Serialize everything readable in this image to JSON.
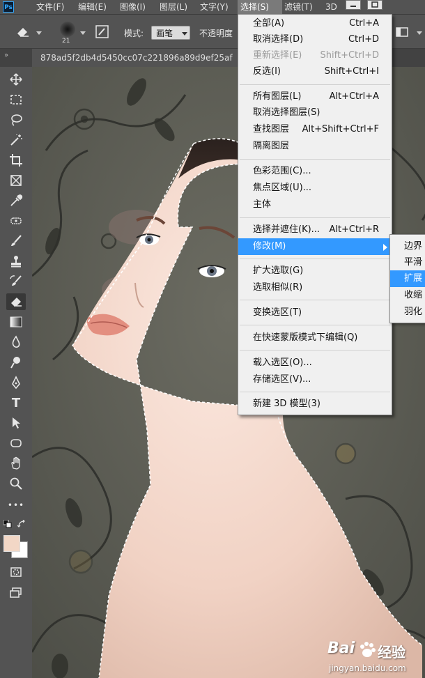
{
  "app": {
    "logo_text": "Ps"
  },
  "menubar": {
    "items": [
      {
        "label": "文件(F)"
      },
      {
        "label": "编辑(E)"
      },
      {
        "label": "图像(I)"
      },
      {
        "label": "图层(L)"
      },
      {
        "label": "文字(Y)"
      },
      {
        "label": "选择(S)"
      },
      {
        "label": "滤镜(T)"
      },
      {
        "label": "3D"
      }
    ],
    "active_item": "选择(S)"
  },
  "options_bar": {
    "brush_size": "21",
    "mode_label": "模式:",
    "mode_value": "画笔",
    "opacity_label": "不透明度"
  },
  "document": {
    "tab_title": "878ad5f2db4d5450cc07c221896a89d9ef25af"
  },
  "toolbar": {
    "tools": [
      "move-tool-icon",
      "marquee-tool-icon",
      "lasso-tool-icon",
      "magic-wand-tool-icon",
      "crop-tool-icon",
      "frame-tool-icon",
      "eyedropper-tool-icon",
      "healing-tool-icon",
      "brush-tool-icon",
      "stamp-tool-icon",
      "history-brush-tool-icon",
      "eraser-tool-icon",
      "gradient-tool-icon",
      "blur-tool-icon",
      "dodge-tool-icon",
      "pen-tool-icon",
      "type-tool-icon",
      "path-selection-tool-icon",
      "shape-tool-icon",
      "hand-tool-icon",
      "zoom-tool-icon",
      "more-tools-icon"
    ],
    "active_tool": "eraser-tool-icon",
    "type_glyph": "T",
    "more_glyph": "•••",
    "foreground_color": "#f2d7c6",
    "background_color": "#ffffff"
  },
  "select_menu": {
    "items": [
      {
        "label": "全部(A)",
        "shortcut": "Ctrl+A",
        "disabled": false
      },
      {
        "label": "取消选择(D)",
        "shortcut": "Ctrl+D",
        "disabled": false
      },
      {
        "label": "重新选择(E)",
        "shortcut": "Shift+Ctrl+D",
        "disabled": true
      },
      {
        "label": "反选(I)",
        "shortcut": "Shift+Ctrl+I",
        "disabled": false
      },
      {
        "label": "所有图层(L)",
        "shortcut": "Alt+Ctrl+A",
        "disabled": false
      },
      {
        "label": "取消选择图层(S)",
        "shortcut": "",
        "disabled": false
      },
      {
        "label": "查找图层",
        "shortcut": "Alt+Shift+Ctrl+F",
        "disabled": false
      },
      {
        "label": "隔离图层",
        "shortcut": "",
        "disabled": false
      },
      {
        "label": "色彩范围(C)...",
        "shortcut": "",
        "disabled": false
      },
      {
        "label": "焦点区域(U)...",
        "shortcut": "",
        "disabled": false
      },
      {
        "label": "主体",
        "shortcut": "",
        "disabled": false
      },
      {
        "label": "选择并遮住(K)...",
        "shortcut": "Alt+Ctrl+R",
        "disabled": false
      },
      {
        "label": "修改(M)",
        "shortcut": "",
        "disabled": false,
        "highlighted": true,
        "submenu": true
      },
      {
        "label": "扩大选取(G)",
        "shortcut": "",
        "disabled": false
      },
      {
        "label": "选取相似(R)",
        "shortcut": "",
        "disabled": false
      },
      {
        "label": "变换选区(T)",
        "shortcut": "",
        "disabled": false
      },
      {
        "label": "在快速蒙版模式下编辑(Q)",
        "shortcut": "",
        "disabled": false
      },
      {
        "label": "载入选区(O)...",
        "shortcut": "",
        "disabled": false
      },
      {
        "label": "存储选区(V)...",
        "shortcut": "",
        "disabled": false
      },
      {
        "label": "新建 3D 模型(3)",
        "shortcut": "",
        "disabled": false
      }
    ]
  },
  "modify_submenu": {
    "items": [
      {
        "label": "边界"
      },
      {
        "label": "平滑"
      },
      {
        "label": "扩展",
        "highlighted": true
      },
      {
        "label": "收缩"
      },
      {
        "label": "羽化"
      }
    ]
  },
  "watermark": {
    "brand": "Bai",
    "brand_suffix": "经验",
    "site": "jingyan.baidu.com"
  },
  "colors": {
    "menu_highlight": "#3399ff",
    "ui_panel": "#535353",
    "canvas_bg": "#5e5f56"
  }
}
